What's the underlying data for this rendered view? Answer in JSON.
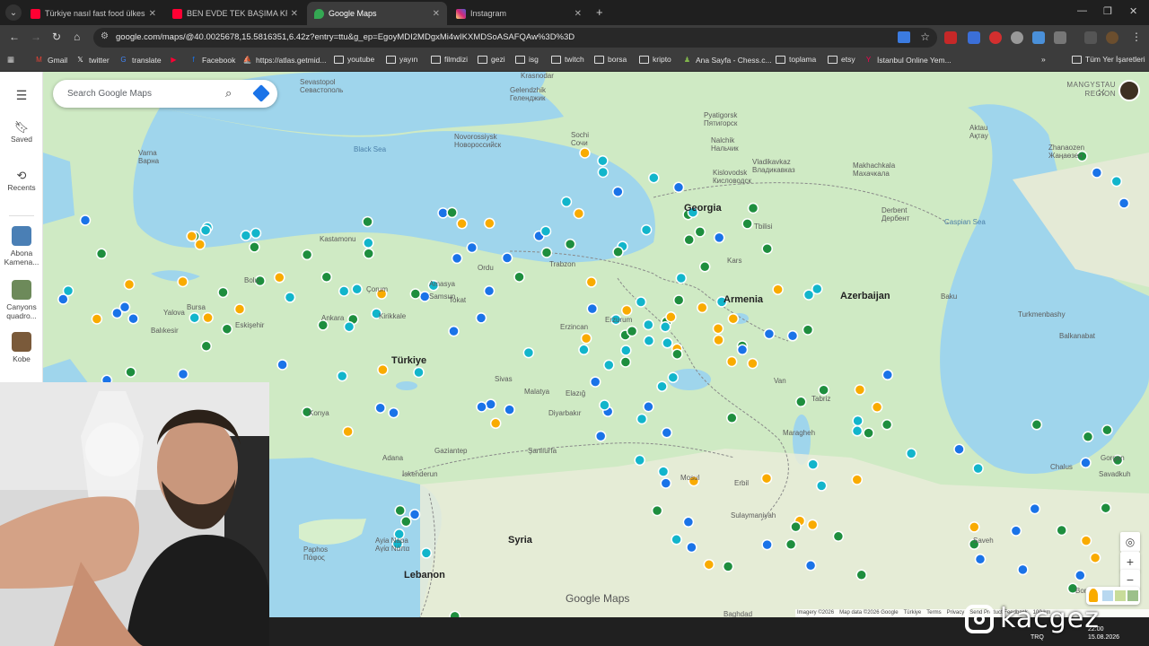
{
  "browser": {
    "tabs": [
      {
        "label": "Türkiye nasıl fast food ülkesi olu",
        "icon": "youtube-icon",
        "color": "#ff0033"
      },
      {
        "label": "BEN EVDE TEK BAŞIMA KRUVAS",
        "icon": "youtube-icon",
        "color": "#ff0033"
      },
      {
        "label": "Google Maps",
        "icon": "google-maps-icon",
        "color": "#34a853"
      },
      {
        "label": "Instagram",
        "icon": "instagram-icon",
        "color": "#e1306c"
      }
    ],
    "url": "google.com/maps/@40.0025678,15.5816351,6.42z?entry=ttu&g_ep=EgoyMDI2MDgxMi4wIKXMDSoASAFQAw%3D%3D",
    "bookmarks": [
      {
        "label": "Gmail",
        "icon": "gmail-icon"
      },
      {
        "label": "twitter",
        "icon": "x-icon"
      },
      {
        "label": "translate",
        "icon": "translate-icon"
      },
      {
        "label": "",
        "icon": "youtube-icon"
      },
      {
        "label": "Facebook",
        "icon": "facebook-icon"
      },
      {
        "label": "https://atlas.getmid...",
        "icon": "midjourney-icon"
      },
      {
        "label": "youtube",
        "icon": "folder-icon"
      },
      {
        "label": "yayın",
        "icon": "folder-icon"
      },
      {
        "label": "filmdizi",
        "icon": "folder-icon"
      },
      {
        "label": "gezi",
        "icon": "folder-icon"
      },
      {
        "label": "isg",
        "icon": "folder-icon"
      },
      {
        "label": "twitch",
        "icon": "folder-icon"
      },
      {
        "label": "borsa",
        "icon": "folder-icon"
      },
      {
        "label": "kripto",
        "icon": "folder-icon"
      },
      {
        "label": "Ana Sayfa - Chess.c...",
        "icon": "chess-icon"
      },
      {
        "label": "toplama",
        "icon": "folder-icon"
      },
      {
        "label": "etsy",
        "icon": "folder-icon"
      },
      {
        "label": "İstanbul Online Yem...",
        "icon": "yemeksepeti-icon"
      }
    ],
    "all_bookmarks": "Tüm Yer İşaretleri"
  },
  "maps": {
    "search_placeholder": "Search Google Maps",
    "sidebar": {
      "saved": "Saved",
      "recents": "Recents",
      "recent_places": [
        {
          "label": "Abona\nKamena...",
          "color": "#4a7fb5"
        },
        {
          "label": "Canyons\nquadro...",
          "color": "#6d8a5a"
        },
        {
          "label": "Kobe",
          "color": "#7a5a3a"
        }
      ]
    },
    "region_label": "MANGYSTAU\nREGION",
    "logo": "Google Maps",
    "attribution": [
      "Imagery ©2026",
      "Map data ©2026 Google",
      "Türkiye",
      "Terms",
      "Privacy",
      "Send Product Feedback",
      "100 km"
    ],
    "place_labels": {
      "countries": [
        "Georgia",
        "Armenia",
        "Azerbaijan",
        "Türkiye",
        "Syria",
        "Lebanon"
      ],
      "cities": [
        "Sevastopol\nСевастополь",
        "Krasnodar",
        "Varna\nВарна",
        "Ankara",
        "Eskişehir",
        "Konya",
        "Tabriz",
        "Tbilisi",
        "Erbil",
        "Diyarbakır",
        "Gaziantep",
        "Erzincan",
        "Erzurum",
        "Samsun",
        "Trabzon",
        "Kastamonu",
        "Ordu",
        "Çorum",
        "Sivas",
        "Malatya",
        "Maragheh",
        "Aktau\nАқтау",
        "Zhanaozen\nЖаңаөзен",
        "Makhachkala\nМахачкала",
        "Derbent\nДербент",
        "Nalchik\nНальчик",
        "Pyatigorsk\nПятигорск",
        "Kislovodsk\nКисловодск",
        "Vladikavkaz\nВладикавказ",
        "Sochi\nСочи",
        "Novorossiysk\nНовороссийск",
        "Gelendzhik\nГеленджик",
        "Turkmenbashy",
        "Balkanabat",
        "Baku",
        "Savadkuh",
        "Gorgan",
        "Chalus",
        "Borujerd",
        "Saveh",
        "Paphos\nΠάφος",
        "Ayia Napa\nΑγία Νάπα",
        "Kirikkale",
        "Bursa",
        "Yalova",
        "Balıkesir",
        "İskenderun",
        "Baghdad",
        "Sulaymaniyah",
        "Mosul",
        "Şanlıurfa",
        "Adana",
        "Kars",
        "Van",
        "Elazığ",
        "Bolu",
        "Tokat",
        "Amasya"
      ],
      "seas": [
        "Black Sea",
        "Caspian Sea"
      ]
    },
    "zoom_in": "+",
    "zoom_out": "−"
  },
  "overlay": {
    "watermark": "kacgez",
    "tray": {
      "lang": "TRQ",
      "time": "22:00",
      "date": "15.08.2026"
    }
  },
  "colors": {
    "map_land": "#cfeac4",
    "map_water": "#9fd5ec",
    "pin_green": "#1e8e3e",
    "pin_cyan": "#12b5cb",
    "pin_blue": "#1a73e8",
    "pin_yellow": "#f9ab00"
  }
}
